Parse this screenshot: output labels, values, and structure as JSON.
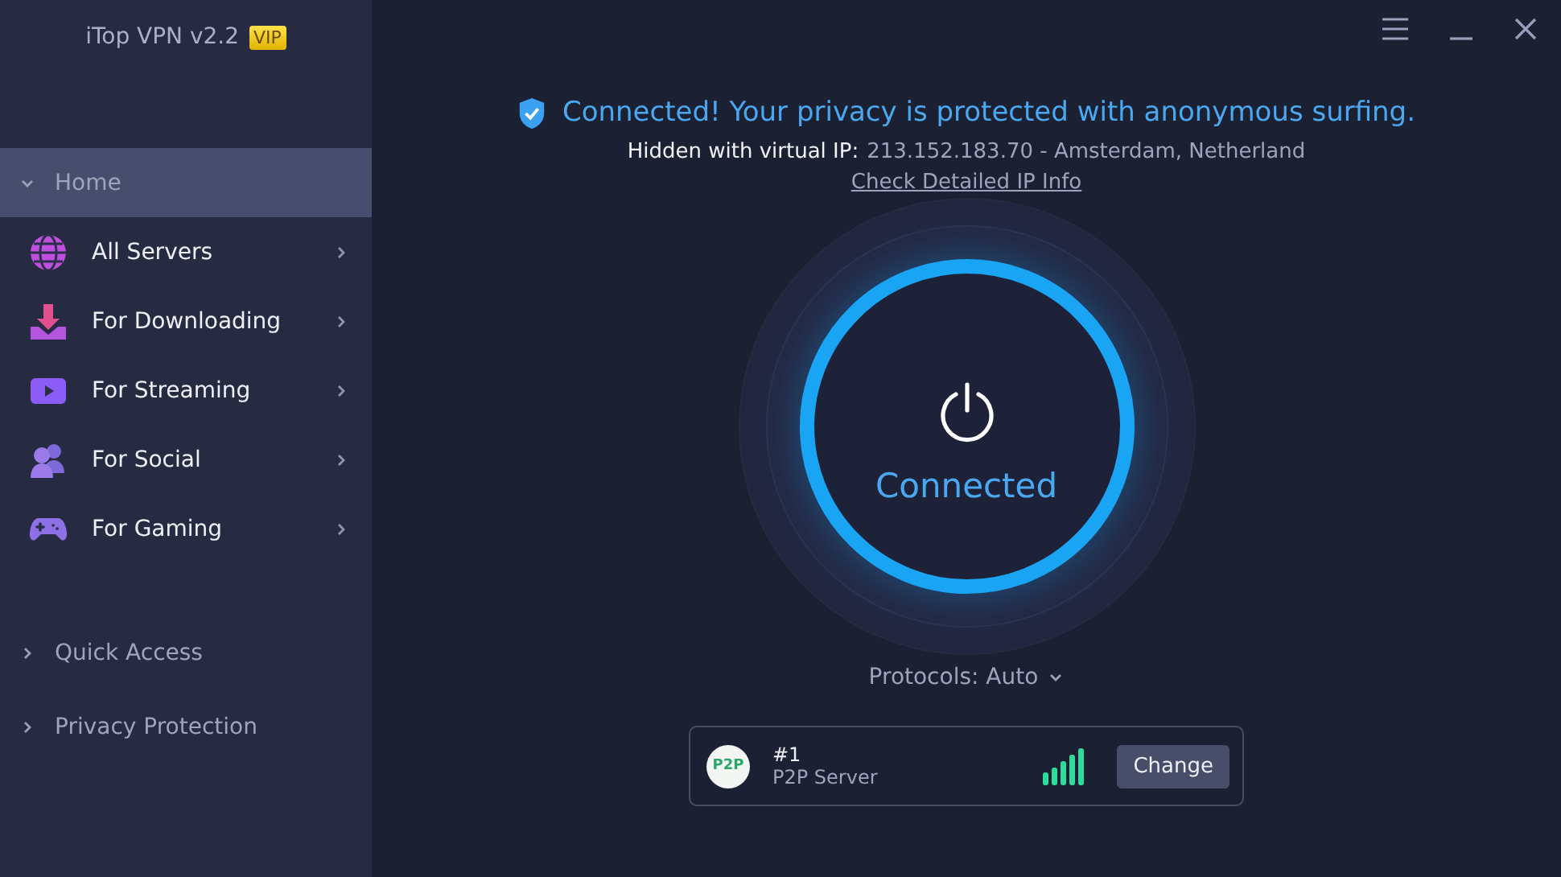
{
  "app": {
    "title": "iTop VPN v2.2",
    "badge": "VIP"
  },
  "sidebar": {
    "sections": [
      {
        "label": "Home",
        "expanded": true,
        "selected": true,
        "children": [
          {
            "label": "All Servers"
          },
          {
            "label": "For Downloading"
          },
          {
            "label": "For Streaming"
          },
          {
            "label": "For Social"
          },
          {
            "label": "For Gaming"
          }
        ]
      },
      {
        "label": "Quick Access",
        "expanded": false,
        "selected": false
      },
      {
        "label": "Privacy Protection",
        "expanded": false,
        "selected": false
      }
    ]
  },
  "status": {
    "message": "Connected! Your privacy is protected with anonymous surfing.",
    "ip_label": "Hidden with virtual IP:",
    "ip_value": "213.152.183.70 - Amsterdam, Netherland",
    "link": "Check Detailed IP Info"
  },
  "power": {
    "on": true,
    "label": "Connected"
  },
  "protocols": "Protocols: Auto",
  "server": {
    "badge": "P2P",
    "number": "#1",
    "name": "P2P Server",
    "action": "Change"
  }
}
